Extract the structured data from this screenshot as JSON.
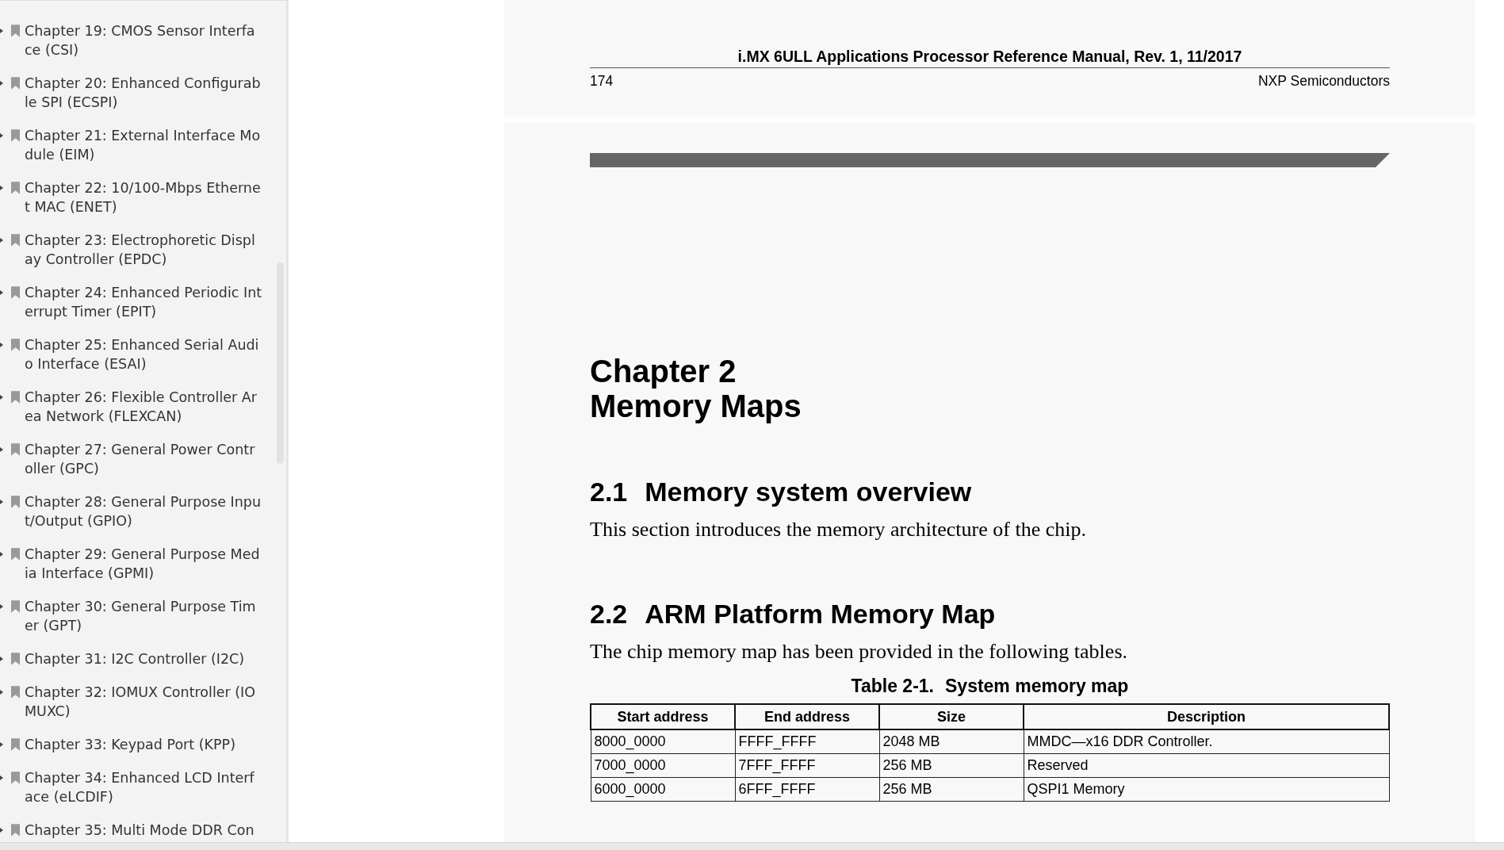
{
  "sidebar": {
    "items": [
      {
        "label": "Chapter 19: CMOS Sensor Interface (CSI)",
        "expanded": false
      },
      {
        "label": "Chapter 20: Enhanced Configurable SPI (ECSPI)",
        "expanded": false
      },
      {
        "label": "Chapter 21: External Interface Module (EIM)",
        "expanded": false
      },
      {
        "label": "Chapter 22: 10/100-Mbps Ethernet MAC (ENET)",
        "expanded": false
      },
      {
        "label": "Chapter 23: Electrophoretic Display Controller (EPDC)",
        "expanded": false
      },
      {
        "label": "Chapter 24: Enhanced Periodic Interrupt Timer (EPIT)",
        "expanded": false
      },
      {
        "label": "Chapter 25: Enhanced Serial Audio Interface (ESAI)",
        "expanded": false
      },
      {
        "label": "Chapter 26: Flexible Controller Area Network (FLEXCAN)",
        "expanded": false
      },
      {
        "label": "Chapter 27: General Power Controller (GPC)",
        "expanded": false
      },
      {
        "label": "Chapter 28: General Purpose Input/Output (GPIO)",
        "expanded": false
      },
      {
        "label": "Chapter 29: General Purpose Media Interface (GPMI)",
        "expanded": false
      },
      {
        "label": "Chapter 30: General Purpose Timer (GPT)",
        "expanded": false
      },
      {
        "label": "Chapter 31: I2C Controller (I2C)",
        "expanded": false
      },
      {
        "label": "Chapter 32: IOMUX Controller (IOMUXC)",
        "expanded": false
      },
      {
        "label": "Chapter 33: Keypad Port (KPP)",
        "expanded": false
      },
      {
        "label": "Chapter 34: Enhanced LCD Interface (eLCDIF)",
        "expanded": false
      },
      {
        "label": "Chapter 35: Multi Mode DDR Con",
        "expanded": false
      }
    ]
  },
  "page_footer": {
    "title": "i.MX 6ULL Applications Processor Reference Manual, Rev. 1, 11/2017",
    "page_number": "174",
    "company": "NXP Semiconductors"
  },
  "page": {
    "chapter": "Chapter 2",
    "chapter_title": "Memory Maps",
    "sections": [
      {
        "number": "2.1",
        "title": "Memory system overview",
        "text": "This section introduces the memory architecture of the chip."
      },
      {
        "number": "2.2",
        "title": "ARM Platform Memory Map",
        "text": "The chip memory map has been provided in the following tables."
      }
    ],
    "table": {
      "caption_number": "Table 2-1.",
      "caption": "System memory map",
      "columns": [
        "Start address",
        "End address",
        "Size",
        "Description"
      ],
      "rows": [
        [
          "8000_0000",
          "FFFF_FFFF",
          "2048 MB",
          "MMDC—x16 DDR Controller."
        ],
        [
          "7000_0000",
          "7FFF_FFFF",
          "256 MB",
          "Reserved"
        ],
        [
          "6000_0000",
          "6FFF_FFFF",
          "256 MB",
          "QSPI1 Memory"
        ]
      ]
    }
  }
}
